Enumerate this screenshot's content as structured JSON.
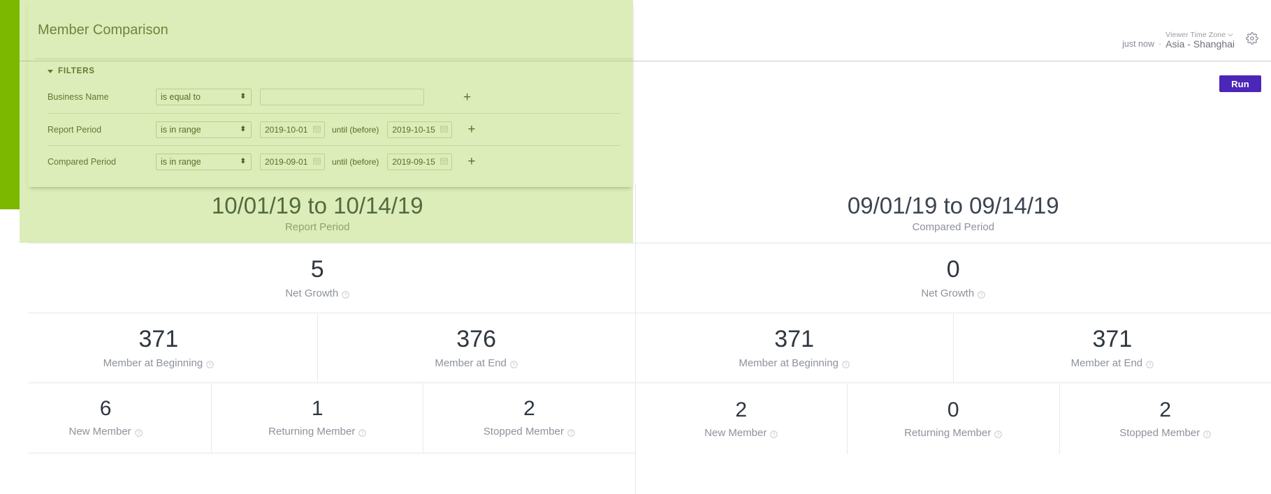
{
  "header": {
    "just_now": "just now",
    "separator": "·",
    "tz_label": "Viewer Time Zone",
    "tz_value": "Asia - Shanghai",
    "gear_icon": "gear-icon",
    "chevron_icon": "chevron-down-icon"
  },
  "toolbar": {
    "run_label": "Run",
    "run_color": "#4b27b8"
  },
  "panel": {
    "title": "Member Comparison",
    "filters_label": "FILTERS",
    "accent_strip_color": "#7cb800",
    "overlay_color": "#dcecb8",
    "add_label": "+",
    "filters": [
      {
        "label": "Business Name",
        "operator": "is equal to",
        "type": "text",
        "value": "",
        "placeholder": ""
      },
      {
        "label": "Report Period",
        "operator": "is in range",
        "type": "daterange",
        "start": "2019-10-01",
        "until_label": "until (before)",
        "end": "2019-10-15"
      },
      {
        "label": "Compared Period",
        "operator": "is in range",
        "type": "daterange",
        "start": "2019-09-01",
        "until_label": "until (before)",
        "end": "2019-09-15"
      }
    ]
  },
  "results": {
    "report": {
      "range": "10/01/19 to 10/14/19",
      "subtitle": "Report Period",
      "net_growth": {
        "value": "5",
        "label": "Net Growth"
      },
      "beginning": {
        "value": "371",
        "label": "Member at Beginning"
      },
      "end": {
        "value": "376",
        "label": "Member at End"
      },
      "new": {
        "value": "6",
        "label": "New Member"
      },
      "returning": {
        "value": "1",
        "label": "Returning Member"
      },
      "stopped": {
        "value": "2",
        "label": "Stopped Member"
      }
    },
    "compared": {
      "range": "09/01/19 to 09/14/19",
      "subtitle": "Compared Period",
      "net_growth": {
        "value": "0",
        "label": "Net Growth"
      },
      "beginning": {
        "value": "371",
        "label": "Member at Beginning"
      },
      "end": {
        "value": "371",
        "label": "Member at End"
      },
      "new": {
        "value": "2",
        "label": "New Member"
      },
      "returning": {
        "value": "0",
        "label": "Returning Member"
      },
      "stopped": {
        "value": "2",
        "label": "Stopped Member"
      }
    }
  }
}
